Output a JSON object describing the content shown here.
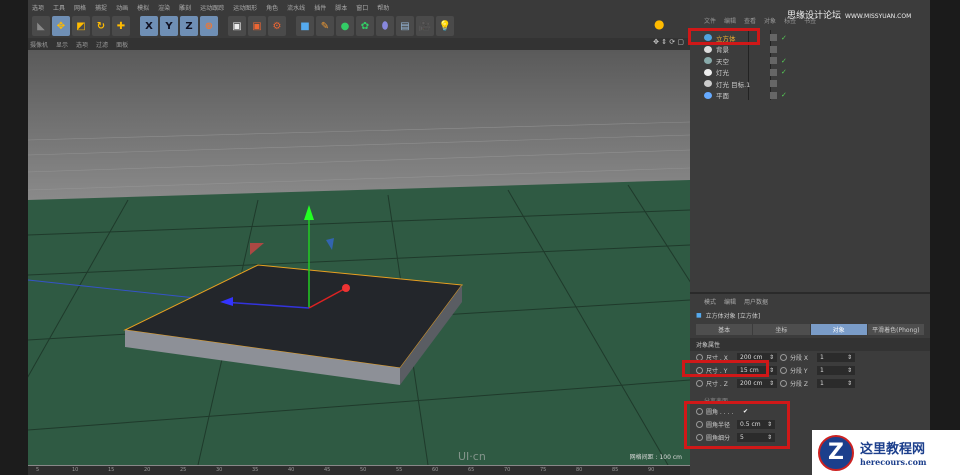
{
  "menu": [
    "选项",
    "工具",
    "网格",
    "捕捉",
    "动画",
    "模拟",
    "渲染",
    "雕刻",
    "运动跟踪",
    "运动图形",
    "角色",
    "流水线",
    "插件",
    "脚本",
    "窗口",
    "帮助"
  ],
  "toolbar": {
    "x": "X",
    "y": "Y",
    "z": "Z"
  },
  "viewport_menu": [
    "摄像机",
    "显示",
    "选项",
    "过滤",
    "面板"
  ],
  "viewport": {
    "grid_spacing": "网格间距 : 100 cm",
    "watermark": "UI·cn"
  },
  "timeline": [
    "5",
    "10",
    "15",
    "20",
    "25",
    "30",
    "35",
    "40",
    "45",
    "50",
    "55",
    "60",
    "65",
    "70",
    "75",
    "80",
    "85",
    "90"
  ],
  "object_manager": {
    "tabs": [
      "文件",
      "编辑",
      "查看",
      "对象",
      "标签",
      "书签"
    ],
    "objects": [
      {
        "name": "立方体",
        "color": "#4fa3e0",
        "selected": true
      },
      {
        "name": "背景",
        "color": "#ddd"
      },
      {
        "name": "天空",
        "color": "#8aa"
      },
      {
        "name": "灯光",
        "color": "#eee"
      },
      {
        "name": "灯光 目标.1",
        "color": "#ccc"
      },
      {
        "name": "平面",
        "color": "#6af"
      }
    ]
  },
  "attributes": {
    "tabs": [
      "模式",
      "编辑",
      "用户数据"
    ],
    "title": "立方体对象 [立方体]",
    "subtabs": [
      "基本",
      "坐标",
      "对象",
      "平滑着色(Phong)"
    ],
    "section": "对象属性",
    "size": [
      {
        "label": "尺寸 . X",
        "value": "200 cm"
      },
      {
        "label": "尺寸 . Y",
        "value": "15 cm"
      },
      {
        "label": "尺寸 . Z",
        "value": "200 cm"
      }
    ],
    "segments": [
      {
        "label": "分段 X",
        "value": "1"
      },
      {
        "label": "分段 Y",
        "value": "1"
      },
      {
        "label": "分段 Z",
        "value": "1"
      }
    ],
    "separate": "分离表面",
    "fillet": {
      "label": "圆角 . . . .",
      "check": "✔"
    },
    "fillet_radius": {
      "label": "圆角半径",
      "value": "0.5 cm"
    },
    "fillet_sub": {
      "label": "圆角细分",
      "value": "5"
    },
    "spin": "⇕"
  },
  "watermark": {
    "cn": "思缘设计论坛",
    "url": "WWW.MISSYUAN.COM"
  },
  "logo": {
    "t1": "这里教程网",
    "t2": "herecours.com",
    "z": "Z"
  }
}
